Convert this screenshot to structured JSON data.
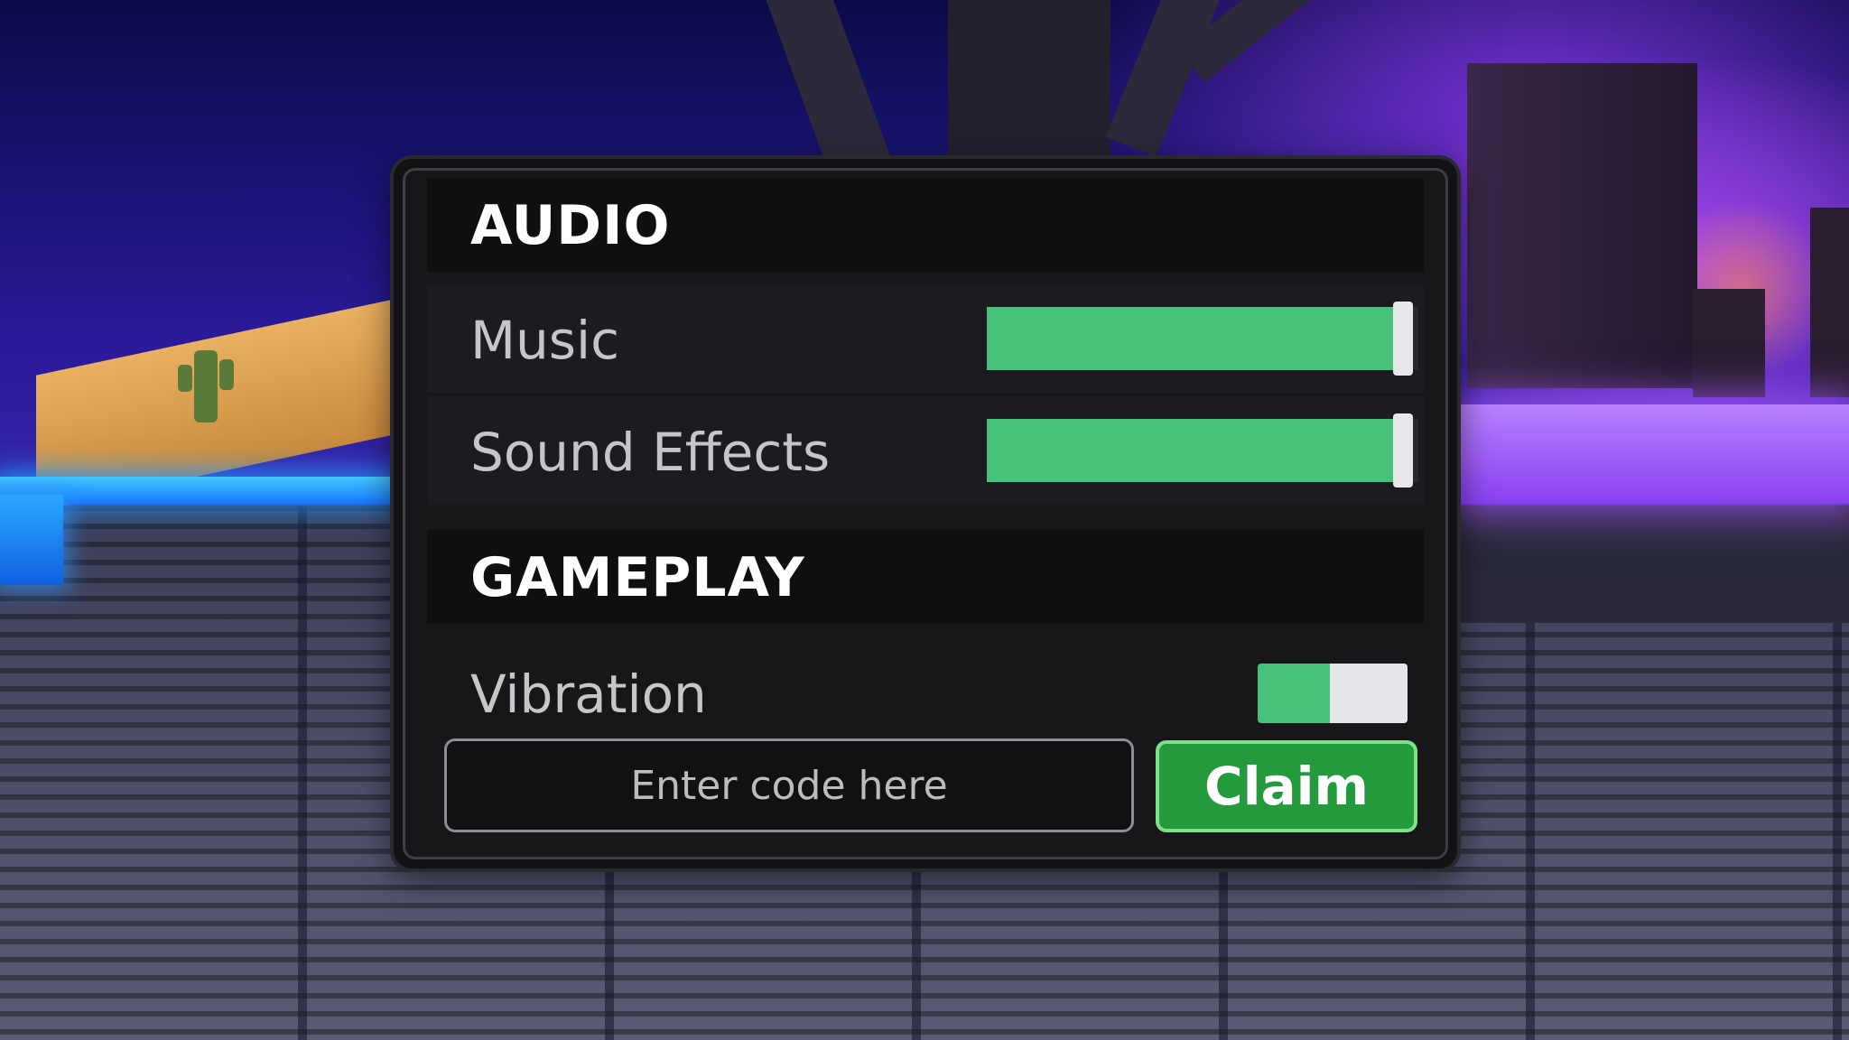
{
  "colors": {
    "accent_green": "#47c27a",
    "claim_green": "#239a3c",
    "panel_bg": "#121214",
    "text_primary": "#ffffff",
    "text_secondary": "#c6c6c8"
  },
  "audio": {
    "title": "AUDIO",
    "music": {
      "label": "Music",
      "level": 0.95
    },
    "sound_effects": {
      "label": "Sound Effects",
      "level": 0.95
    }
  },
  "gameplay": {
    "title": "GAMEPLAY",
    "vibration": {
      "label": "Vibration",
      "enabled": false
    }
  },
  "code_redeem": {
    "placeholder": "Enter code here",
    "value": "",
    "button_label": "Claim"
  }
}
